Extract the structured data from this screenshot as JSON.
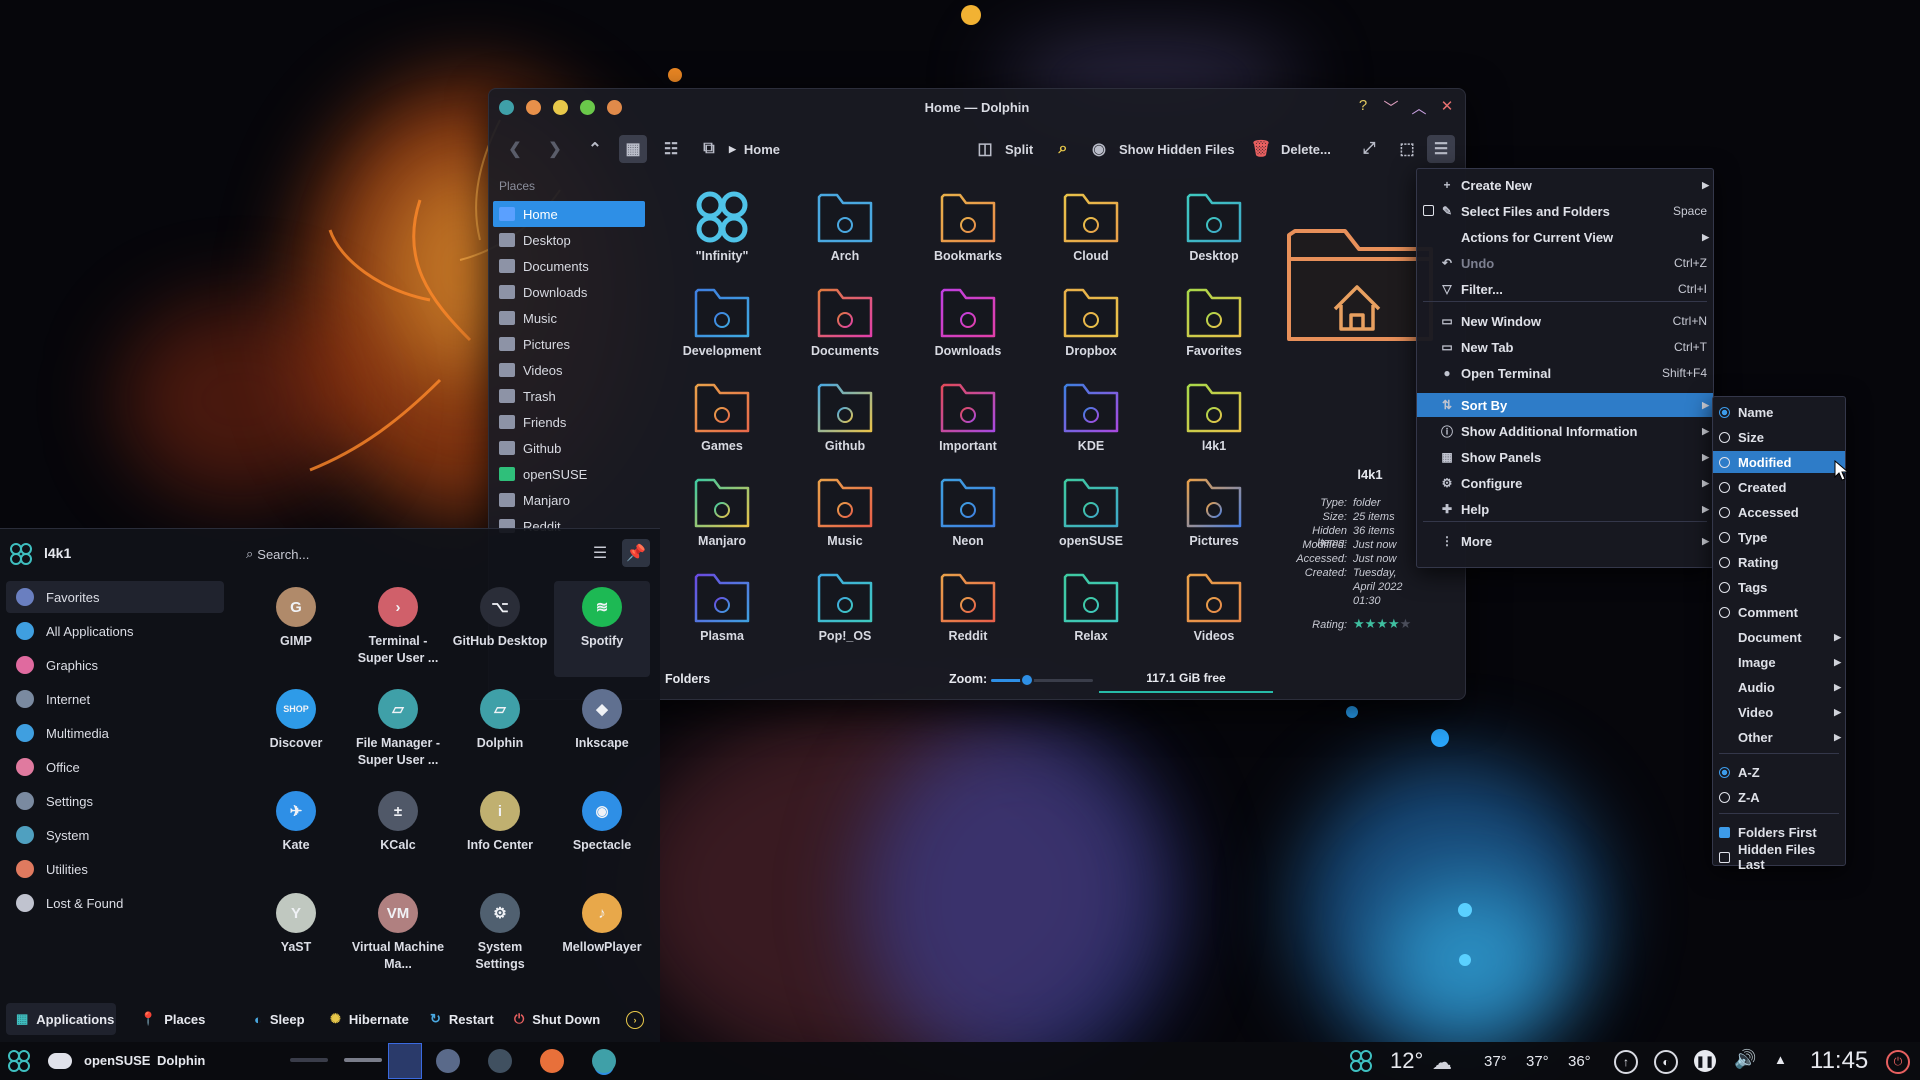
{
  "window": {
    "title": "Home — Dolphin",
    "controls": {
      "help": "?",
      "minimize": "﹀",
      "maximize": "︿",
      "close": "✕"
    }
  },
  "toolbar": {
    "location": "Home",
    "split": "Split",
    "show_hidden": "Show Hidden Files",
    "delete": "Delete..."
  },
  "places": {
    "header": "Places",
    "items": [
      {
        "label": "Home",
        "color": "#5aa0ff"
      },
      {
        "label": "Desktop",
        "color": "#8d93a6"
      },
      {
        "label": "Documents",
        "color": "#8d93a6"
      },
      {
        "label": "Downloads",
        "color": "#8d93a6"
      },
      {
        "label": "Music",
        "color": "#8d93a6"
      },
      {
        "label": "Pictures",
        "color": "#8d93a6"
      },
      {
        "label": "Videos",
        "color": "#8d93a6"
      },
      {
        "label": "Trash",
        "color": "#8d93a6"
      },
      {
        "label": "Friends",
        "color": "#8d93a6"
      },
      {
        "label": "Github",
        "color": "#8d93a6"
      },
      {
        "label": "openSUSE",
        "color": "#2fbf7a"
      },
      {
        "label": "Manjaro",
        "color": "#8d93a6"
      },
      {
        "label": "Reddit",
        "color": "#8d93a6"
      }
    ]
  },
  "files": [
    {
      "label": "\"Infinity\"",
      "c1": "#4fc3e8",
      "c2": "#4fc3e8",
      "icon": "infinity"
    },
    {
      "label": "Arch",
      "c1": "#4aa8e0",
      "c2": "#4aa8e0",
      "icon": "arch"
    },
    {
      "label": "Bookmarks",
      "c1": "#e8b04a",
      "c2": "#e88a4a",
      "icon": "bookmark"
    },
    {
      "label": "Cloud",
      "c1": "#e8c24a",
      "c2": "#e8a04a",
      "icon": "cloud"
    },
    {
      "label": "Desktop",
      "c1": "#3fc9c0",
      "c2": "#3fa9c9",
      "icon": "desktop"
    },
    {
      "label": "Development",
      "c1": "#3f7fe0",
      "c2": "#3fa9e0",
      "icon": "dev"
    },
    {
      "label": "Documents",
      "c1": "#e07a3f",
      "c2": "#e03fa9",
      "icon": "doc"
    },
    {
      "label": "Downloads",
      "c1": "#c03fe0",
      "c2": "#e03fa9",
      "icon": "down"
    },
    {
      "label": "Dropbox",
      "c1": "#e8b04a",
      "c2": "#e8c24a",
      "icon": "cloud"
    },
    {
      "label": "Favorites",
      "c1": "#a8d84a",
      "c2": "#e8c24a",
      "icon": "star"
    },
    {
      "label": "Games",
      "c1": "#e8a04a",
      "c2": "#e86a4a",
      "icon": "game"
    },
    {
      "label": "Github",
      "c1": "#4aa8e0",
      "c2": "#e8c24a",
      "icon": "gh"
    },
    {
      "label": "Important",
      "c1": "#e04a5a",
      "c2": "#a84ae0",
      "icon": "imp"
    },
    {
      "label": "KDE",
      "c1": "#3f7fe0",
      "c2": "#a84ae0",
      "icon": "kde"
    },
    {
      "label": "l4k1",
      "c1": "#a8d84a",
      "c2": "#e8c24a",
      "icon": "l4k1"
    },
    {
      "label": "Manjaro",
      "c1": "#3fc9a0",
      "c2": "#e8c24a",
      "icon": "manjaro"
    },
    {
      "label": "Music",
      "c1": "#e8a04a",
      "c2": "#e8604a",
      "icon": "music"
    },
    {
      "label": "Neon",
      "c1": "#3f9fe0",
      "c2": "#3f7fe0",
      "icon": "neon"
    },
    {
      "label": "openSUSE",
      "c1": "#3fc9a0",
      "c2": "#3fa9c9",
      "icon": "suse"
    },
    {
      "label": "Pictures",
      "c1": "#e8a04a",
      "c2": "#4a7fe0",
      "icon": "pics"
    },
    {
      "label": "Plasma",
      "c1": "#6a4ae0",
      "c2": "#3f9fe0",
      "icon": "plasma"
    },
    {
      "label": "Pop!_OS",
      "c1": "#3fa9e0",
      "c2": "#3fc9c0",
      "icon": "pop"
    },
    {
      "label": "Reddit",
      "c1": "#e8a04a",
      "c2": "#e8604a",
      "icon": "reddit"
    },
    {
      "label": "Relax",
      "c1": "#3fc9a0",
      "c2": "#3fc9c0",
      "icon": "relax"
    },
    {
      "label": "Videos",
      "c1": "#e8a04a",
      "c2": "#e88a4a",
      "icon": "video"
    }
  ],
  "info_panel": {
    "name": "l4k1",
    "rows": [
      {
        "key": "Type:",
        "value": "folder"
      },
      {
        "key": "Size:",
        "value": "25 items"
      },
      {
        "key": "Hidden Items:",
        "value": "36 items"
      },
      {
        "key": "Modified:",
        "value": "Just now"
      },
      {
        "key": "Accessed:",
        "value": "Just now"
      },
      {
        "key": "Created:",
        "value": "Tuesday,"
      },
      {
        "key": "",
        "value": "April 2022"
      },
      {
        "key": "",
        "value": "01:30"
      }
    ],
    "rating_label": "Rating:",
    "rating": 4
  },
  "statusbar": {
    "folders": "Folders",
    "zoom_label": "Zoom:",
    "zoom_level": 0.35,
    "free_space": "117.1 GiB free",
    "used_fraction": 0.0
  },
  "hamburger_menu": [
    {
      "label": "Create New",
      "icon": "+",
      "shortcut": "",
      "submenu": true
    },
    {
      "label": "Select Files and Folders",
      "icon": "✎",
      "shortcut": "Space",
      "submenu": false,
      "checkbox": true
    },
    {
      "label": "Actions for Current View",
      "icon": "",
      "shortcut": "",
      "submenu": true
    },
    {
      "label": "Undo",
      "icon": "↶",
      "shortcut": "Ctrl+Z",
      "submenu": false,
      "disabled": true
    },
    {
      "label": "Filter...",
      "icon": "▽",
      "shortcut": "Ctrl+I",
      "submenu": false
    },
    {
      "label": "New Window",
      "icon": "▭",
      "shortcut": "Ctrl+N",
      "submenu": false
    },
    {
      "label": "New Tab",
      "icon": "▭",
      "shortcut": "Ctrl+T",
      "submenu": false
    },
    {
      "label": "Open Terminal",
      "icon": "●",
      "shortcut": "Shift+F4",
      "submenu": false
    },
    {
      "label": "Sort By",
      "icon": "⇅",
      "shortcut": "",
      "submenu": true,
      "highlight": true
    },
    {
      "label": "Show Additional Information",
      "icon": "ⓘ",
      "shortcut": "",
      "submenu": true
    },
    {
      "label": "Show Panels",
      "icon": "▦",
      "shortcut": "",
      "submenu": true
    },
    {
      "label": "Configure",
      "icon": "⚙",
      "shortcut": "",
      "submenu": true
    },
    {
      "label": "Help",
      "icon": "✚",
      "shortcut": "",
      "submenu": true
    },
    {
      "label": "More",
      "icon": "⋮",
      "shortcut": "",
      "submenu": true
    }
  ],
  "sort_menu": [
    {
      "label": "Name",
      "control": "radio",
      "checked": true
    },
    {
      "label": "Size",
      "control": "radio",
      "checked": false
    },
    {
      "label": "Modified",
      "control": "radio",
      "checked": false,
      "highlight": true
    },
    {
      "label": "Created",
      "control": "radio",
      "checked": false
    },
    {
      "label": "Accessed",
      "control": "radio",
      "checked": false
    },
    {
      "label": "Type",
      "control": "radio",
      "checked": false
    },
    {
      "label": "Rating",
      "control": "radio",
      "checked": false
    },
    {
      "label": "Tags",
      "control": "radio",
      "checked": false
    },
    {
      "label": "Comment",
      "control": "radio",
      "checked": false
    },
    {
      "label": "Document",
      "control": "none",
      "submenu": true
    },
    {
      "label": "Image",
      "control": "none",
      "submenu": true
    },
    {
      "label": "Audio",
      "control": "none",
      "submenu": true
    },
    {
      "label": "Video",
      "control": "none",
      "submenu": true
    },
    {
      "label": "Other",
      "control": "none",
      "submenu": true
    },
    {
      "label": "A-Z",
      "control": "radio",
      "checked": true
    },
    {
      "label": "Z-A",
      "control": "radio",
      "checked": false
    },
    {
      "label": "Folders First",
      "control": "check",
      "checked": true
    },
    {
      "label": "Hidden Files Last",
      "control": "check",
      "checked": false
    }
  ],
  "launcher": {
    "user": "l4k1",
    "search_placeholder": "Search...",
    "categories": [
      {
        "label": "Favorites",
        "color": "#6a7fc0"
      },
      {
        "label": "All Applications",
        "color": "#3f9fe0"
      },
      {
        "label": "Graphics",
        "color": "#e06a9f"
      },
      {
        "label": "Internet",
        "color": "#7a8aa0"
      },
      {
        "label": "Multimedia",
        "color": "#3f9fe0"
      },
      {
        "label": "Office",
        "color": "#e07a9f"
      },
      {
        "label": "Settings",
        "color": "#7a8aa0"
      },
      {
        "label": "System",
        "color": "#4fa0c0"
      },
      {
        "label": "Utilities",
        "color": "#e07a5f"
      },
      {
        "label": "Lost & Found",
        "color": "#c0c3cf"
      }
    ],
    "apps": [
      {
        "label": "GIMP",
        "color": "#b08a6a",
        "glyph": "G"
      },
      {
        "label": "Terminal - Super User ...",
        "color": "#d0606a",
        "glyph": "›"
      },
      {
        "label": "GitHub Desktop",
        "color": "#2a2d38",
        "glyph": "⌥"
      },
      {
        "label": "Spotify",
        "color": "#1db954",
        "glyph": "≋"
      },
      {
        "label": "Discover",
        "color": "#2e9be8",
        "glyph": "SHOP"
      },
      {
        "label": "File Manager - Super User ...",
        "color": "#3fa0a8",
        "glyph": "▱"
      },
      {
        "label": "Dolphin",
        "color": "#3fa0a8",
        "glyph": "▱"
      },
      {
        "label": "Inkscape",
        "color": "#607090",
        "glyph": "◆"
      },
      {
        "label": "Kate",
        "color": "#2e8fe6",
        "glyph": "✈"
      },
      {
        "label": "KCalc",
        "color": "#505868",
        "glyph": "±"
      },
      {
        "label": "Info Center",
        "color": "#c0b070",
        "glyph": "i"
      },
      {
        "label": "Spectacle",
        "color": "#2e8fe6",
        "glyph": "◉"
      },
      {
        "label": "YaST",
        "color": "#c0c8c0",
        "glyph": "Y"
      },
      {
        "label": "Virtual Machine Ma...",
        "color": "#b08080",
        "glyph": "VM"
      },
      {
        "label": "System Settings",
        "color": "#506070",
        "glyph": "⚙"
      },
      {
        "label": "MellowPlayer",
        "color": "#e8a84a",
        "glyph": "♪"
      }
    ],
    "footer": {
      "applications": "Applications",
      "places": "Places",
      "sleep": "Sleep",
      "hibernate": "Hibernate",
      "restart": "Restart",
      "shutdown": "Shut Down"
    }
  },
  "taskbar": {
    "distro": "openSUSE",
    "active_app": "Dolphin",
    "weather_temp": "12°",
    "temps": [
      "37°",
      "37°",
      "36°"
    ],
    "clock": "11:45"
  },
  "colors": {
    "accent": "#2e8fe6",
    "menu_highlight": "#2e7cc8"
  }
}
